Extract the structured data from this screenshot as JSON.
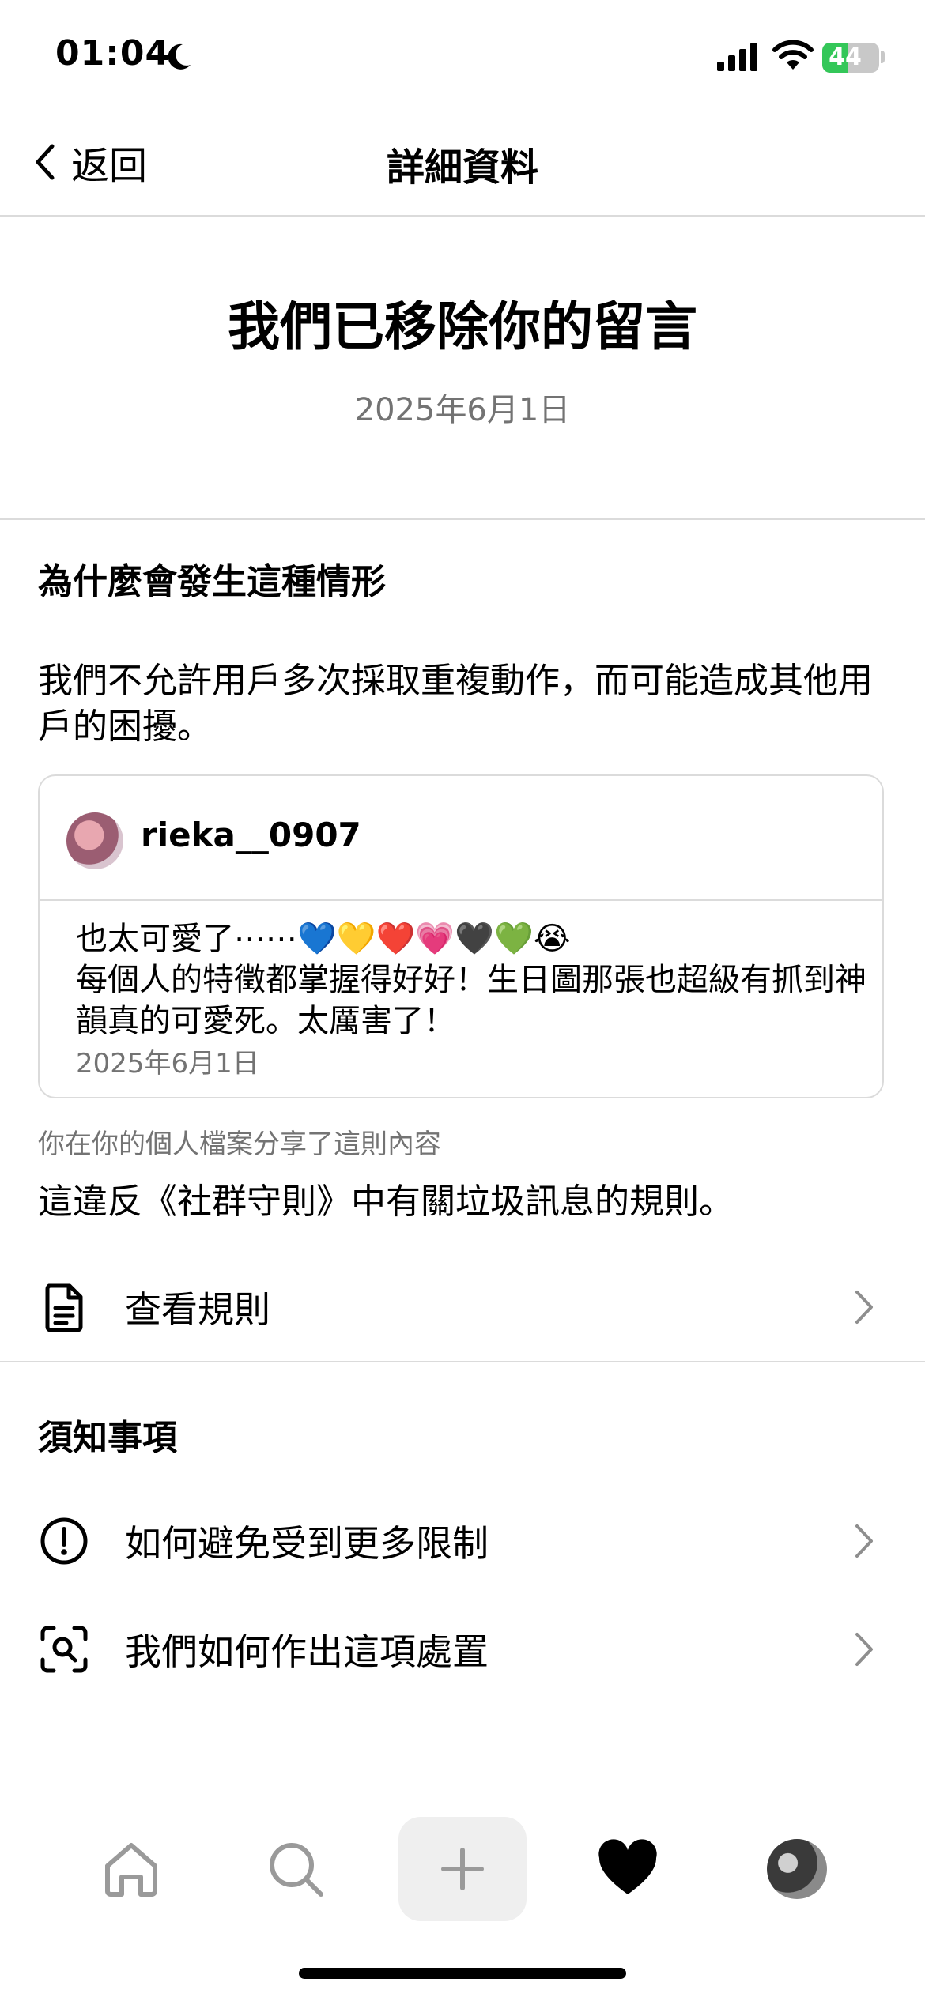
{
  "status_bar": {
    "time": "01:04",
    "battery": "44",
    "battery_level": 0.44
  },
  "nav": {
    "back_label": "返回",
    "title": "詳細資料"
  },
  "header": {
    "title": "我們已移除你的留言",
    "date": "2025年6月1日"
  },
  "reason": {
    "title": "為什麼會發生這種情形",
    "description": "我們不允許用戶多次採取重複動作，而可能造成其他用戶的困擾。"
  },
  "comment_card": {
    "username": "rieka__0907",
    "line1": "也太可愛了⋯⋯💙💛❤️💗🖤💚😭",
    "line2": "每個人的特徵都掌握得好好！生日圖那張也超級有抓到神韻真的可愛死。太厲害了！",
    "date": "2025年6月1日"
  },
  "shared_caption": "你在你的個人檔案分享了這則內容",
  "violation_text": "這違反《社群守則》中有關垃圾訊息的規則。",
  "view_rules": {
    "label": "查看規則",
    "icon": "document-icon"
  },
  "notes": {
    "title": "須知事項",
    "items": [
      {
        "label": "如何避免受到更多限制",
        "icon": "alert-circle-icon"
      },
      {
        "label": "我們如何作出這項處置",
        "icon": "scan-search-icon"
      }
    ]
  },
  "tab_bar": {
    "items": [
      "home-icon",
      "search-icon",
      "create-icon",
      "activity-heart-icon",
      "profile-avatar"
    ],
    "active": "activity-heart-icon"
  }
}
